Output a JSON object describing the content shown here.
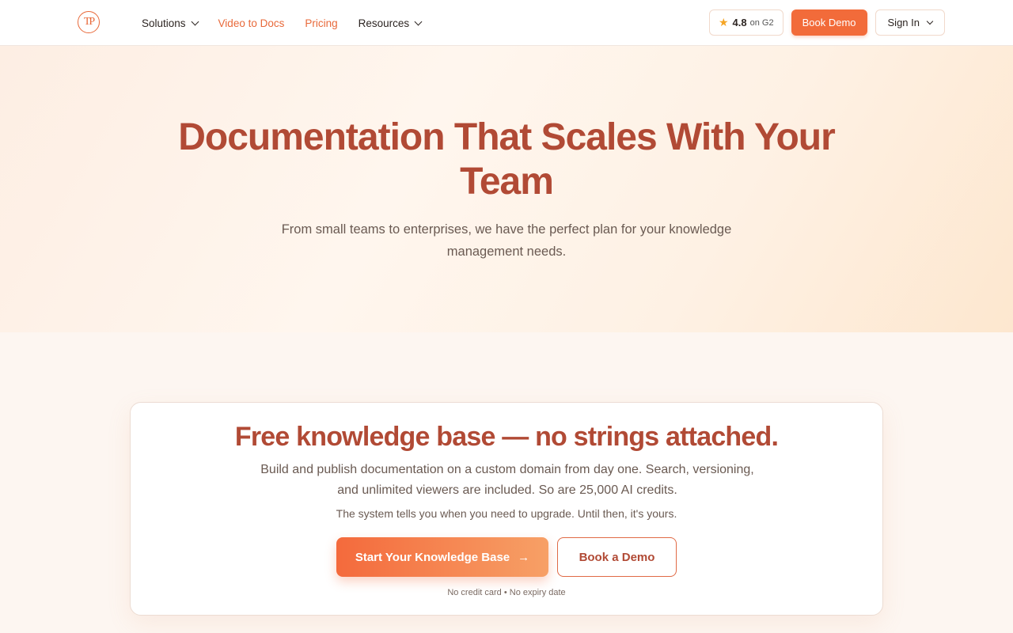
{
  "header": {
    "logo_text": "TP",
    "nav": [
      {
        "label": "Solutions",
        "has_dropdown": true,
        "accent": false
      },
      {
        "label": "Video to Docs",
        "has_dropdown": false,
        "accent": true
      },
      {
        "label": "Pricing",
        "has_dropdown": false,
        "accent": true
      },
      {
        "label": "Resources",
        "has_dropdown": true,
        "accent": false
      }
    ],
    "rating": {
      "value": "4.8",
      "suffix": "on G2",
      "icon": "star-icon"
    },
    "book_demo_label": "Book Demo",
    "sign_in_label": "Sign In"
  },
  "hero": {
    "title": "Documentation That Scales With Your Team",
    "subtitle": "From small teams to enterprises, we have the perfect plan for your knowledge management needs."
  },
  "card": {
    "title": "Free knowledge base — no strings attached.",
    "description": "Build and publish documentation on a custom domain from day one. Search, versioning, and unlimited viewers are included. So are 25,000 AI credits.",
    "note": "The system tells you when you need to upgrade. Until then, it's yours.",
    "primary_cta": "Start Your Knowledge Base",
    "secondary_cta": "Book a Demo",
    "footnote": "No credit card • No expiry date"
  },
  "colors": {
    "accent": "#f26b3a",
    "heading": "#b14a35"
  }
}
